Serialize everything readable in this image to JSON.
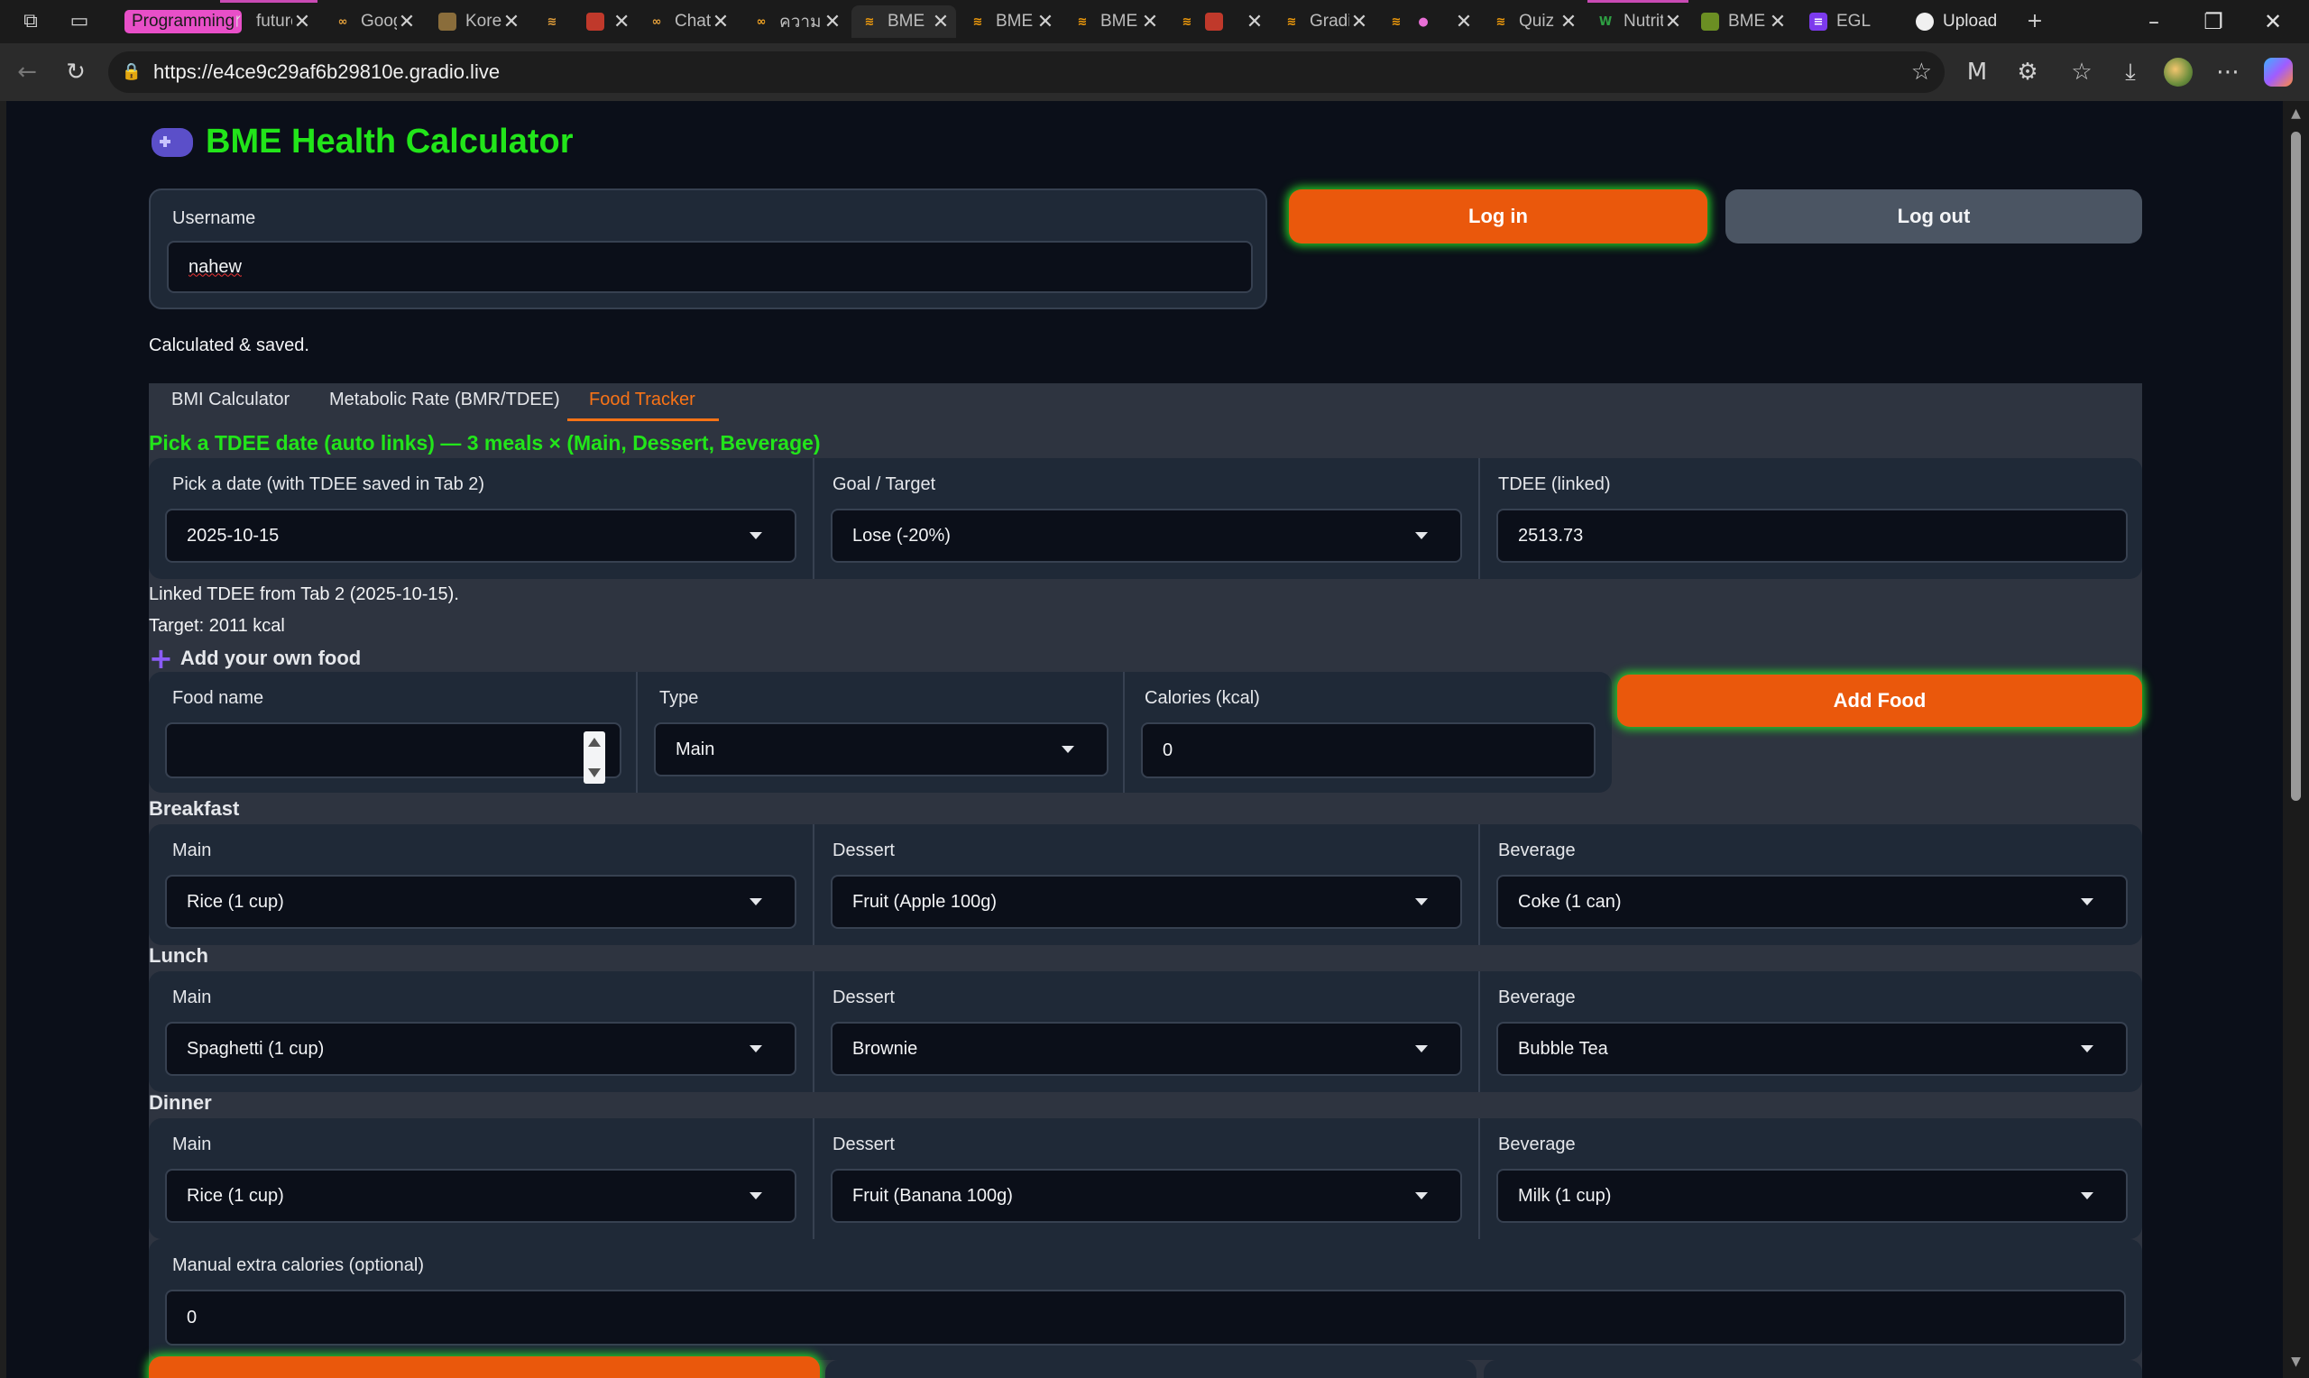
{
  "browser": {
    "group_label": "Programming",
    "tabs": [
      {
        "title": "futures"
      },
      {
        "title": "Google"
      },
      {
        "title": "Korean"
      },
      {
        "title": ""
      },
      {
        "title": ""
      },
      {
        "title": "ChatGPT"
      },
      {
        "title": "ความ"
      },
      {
        "title": "BME"
      },
      {
        "title": "BME"
      },
      {
        "title": "BME"
      },
      {
        "title": ""
      },
      {
        "title": "Gradio"
      },
      {
        "title": ""
      },
      {
        "title": "Quiz"
      },
      {
        "title": "Nutrition"
      },
      {
        "title": "BME"
      },
      {
        "title": "EGL"
      },
      {
        "title": "Upload"
      }
    ],
    "url": "https://e4ce9c29af6b29810e.gradio.live"
  },
  "app": {
    "title": "BME Health Calculator",
    "username_label": "Username",
    "username_value": "nahew",
    "login_label": "Log in",
    "logout_label": "Log out",
    "status": "Calculated & saved."
  },
  "tabs": {
    "bmi": "BMI Calculator",
    "bmr": "Metabolic Rate (BMR/TDEE)",
    "food": "Food Tracker"
  },
  "food_tracker": {
    "heading": "Pick a TDEE date (auto links) — 3 meals × (Main, Dessert, Beverage)",
    "date_label": "Pick a date (with TDEE saved in Tab 2)",
    "date_value": "2025-10-15",
    "goal_label": "Goal / Target",
    "goal_value": "Lose (-20%)",
    "tdee_label": "TDEE (linked)",
    "tdee_value": "2513.73",
    "linked_note": "Linked TDEE from Tab 2 (2025-10-15).",
    "target_note": "Target: 2011 kcal",
    "add_own_heading": "Add your own food",
    "food_name_label": "Food name",
    "food_name_value": "",
    "type_label": "Type",
    "type_value": "Main",
    "calories_label": "Calories (kcal)",
    "calories_value": "0",
    "add_food_label": "Add Food",
    "meals": [
      {
        "name": "Breakfast",
        "main_label": "Main",
        "main": "Rice (1 cup)",
        "dessert_label": "Dessert",
        "dessert": "Fruit (Apple 100g)",
        "beverage_label": "Beverage",
        "beverage": "Coke (1 can)"
      },
      {
        "name": "Lunch",
        "main_label": "Main",
        "main": "Spaghetti (1 cup)",
        "dessert_label": "Dessert",
        "dessert": "Brownie",
        "beverage_label": "Beverage",
        "beverage": "Bubble Tea"
      },
      {
        "name": "Dinner",
        "main_label": "Main",
        "main": "Rice (1 cup)",
        "dessert_label": "Dessert",
        "dessert": "Fruit (Banana 100g)",
        "beverage_label": "Beverage",
        "beverage": "Milk (1 cup)"
      }
    ],
    "manual_label": "Manual extra calories (optional)",
    "manual_value": "0"
  },
  "colors": {
    "accent_green": "#22e51a",
    "primary_orange": "#ea580c",
    "tab_selected": "#f97316",
    "page_bg": "#0b0f19"
  }
}
